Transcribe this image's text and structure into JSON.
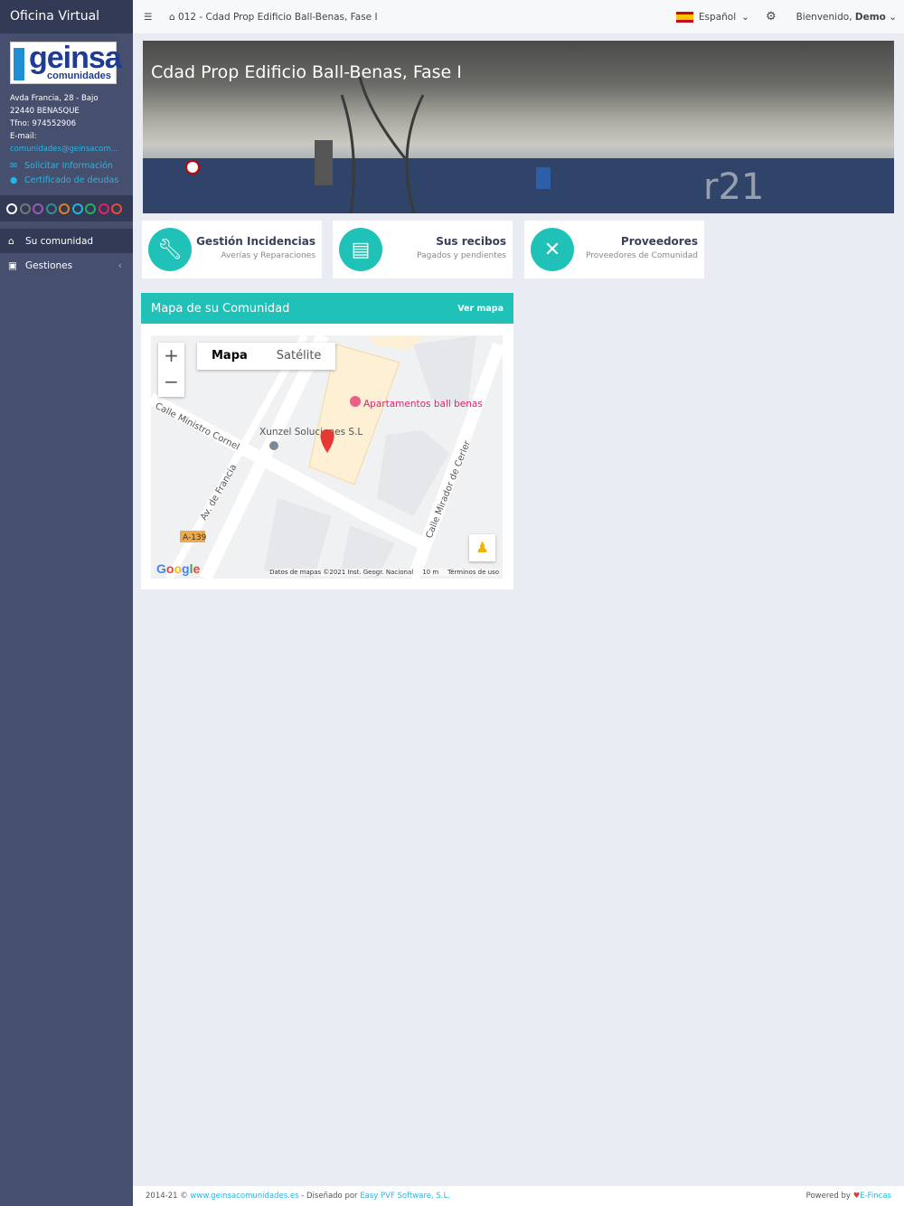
{
  "sidebar": {
    "brand": "Oficina Virtual",
    "logo_text": "geinsa",
    "logo_sub": "comunidades",
    "address": [
      "Avda Francia, 28 - Bajo",
      "22440 BENASQUE",
      "Tfno: 974552906",
      "E-mail:"
    ],
    "email": "comunidades@geinsacom...",
    "actions": [
      {
        "icon": "envelope-icon",
        "label": "Solicitar Información"
      },
      {
        "icon": "certificate-icon",
        "label": "Certificado de deudas"
      }
    ],
    "theme_colors": [
      "#ffffff",
      "#777777",
      "#9b59b6",
      "#3a8c8c",
      "#e67e22",
      "#1fb5e0",
      "#27ae60",
      "#e91e63",
      "#e74c3c"
    ],
    "nav": [
      {
        "icon": "home-icon",
        "label": "Su comunidad",
        "active": true
      },
      {
        "icon": "briefcase-icon",
        "label": "Gestiones",
        "active": false
      }
    ]
  },
  "topbar": {
    "breadcrumb": "012 - Cdad Prop Edificio Ball-Benas, Fase I",
    "language": "Español",
    "welcome": "Bienvenido,",
    "user": "Demo"
  },
  "hero": {
    "title": "Cdad Prop Edificio Ball-Benas, Fase I"
  },
  "cards": [
    {
      "icon": "wrench-icon",
      "title": "Gestión Incidencias",
      "subtitle": "Averías y Reparaciones"
    },
    {
      "icon": "receipt-icon",
      "title": "Sus recibos",
      "subtitle": "Pagados y pendientes"
    },
    {
      "icon": "tools-icon",
      "title": "Proveedores",
      "subtitle": "Proveedores de Comunidad"
    }
  ],
  "map_panel": {
    "title": "Mapa de su Comunidad",
    "link": "Ver mapa",
    "map_type": [
      "Mapa",
      "Satélite"
    ],
    "labels": {
      "poi1": "Apartamentos ball benas",
      "poi2": "Xunzel Soluciones S.L",
      "street1": "Calle Ministro Cornel",
      "street2": "Av. de Francia",
      "street3": "Calle Mirador de Cerler",
      "road": "A-139"
    },
    "attribution": "Datos de mapas ©2021 Inst. Geogr. Nacional",
    "scale": "10 m",
    "terms": "Términos de uso",
    "google": "Google"
  },
  "footer": {
    "years": "2014-21 ©",
    "site": "www.geinsacomunidades.es",
    "designed": "- Diseñado por",
    "designer": "Easy PVF Software, S.L.",
    "powered": "Powered by",
    "brand": "E-Fincas"
  },
  "colors": {
    "accent": "#20c2b7",
    "sidebar": "#474f6f",
    "sidebar_dark": "#323a55"
  }
}
